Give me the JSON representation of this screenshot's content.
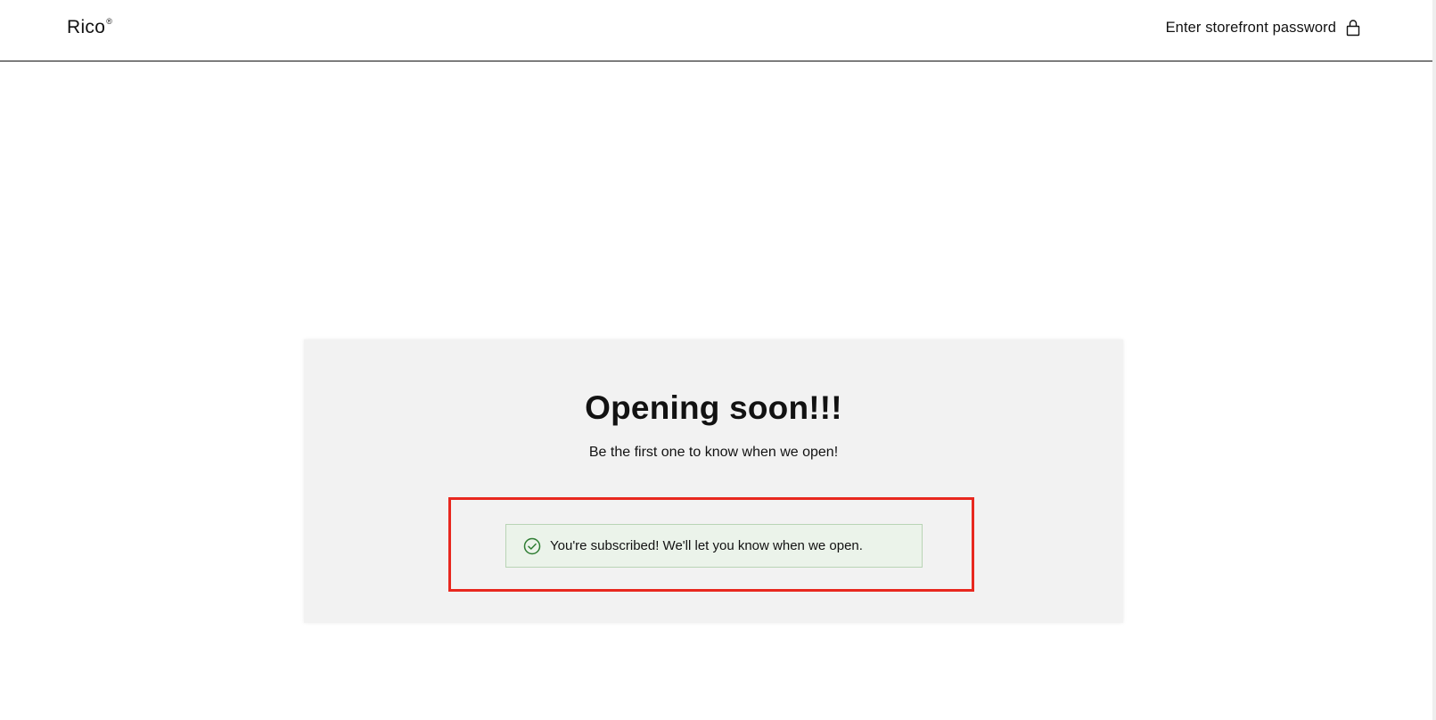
{
  "header": {
    "logo_text": "Rico",
    "logo_mark": "®",
    "password_link_label": "Enter storefront password",
    "password_icon": "lock-icon"
  },
  "main": {
    "title": "Opening soon!!!",
    "subtitle": "Be the first one to know when we open!",
    "success_message": "You're subscribed! We'll let you know when we open.",
    "success_icon": "check-circle-icon"
  },
  "colors": {
    "text": "#121212",
    "card_background": "#f2f2f2",
    "success_background": "#ebf3ea",
    "success_border": "#b9d4b5",
    "success_icon": "#2e7d32",
    "highlight_border": "#e8281f"
  }
}
